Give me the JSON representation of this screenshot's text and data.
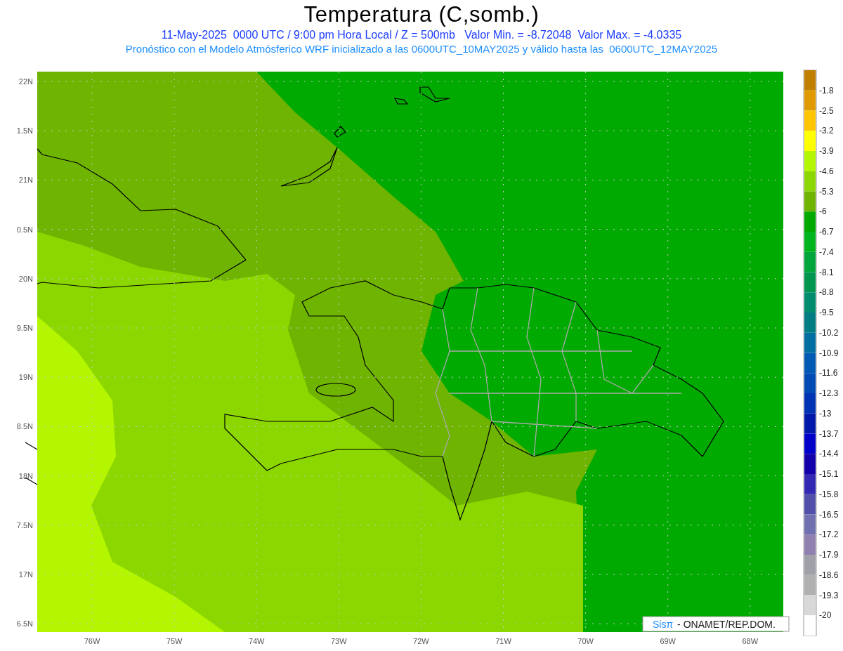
{
  "title": "Temperatura (C,somb.)",
  "subtitle": "11-May-2025  0000 UTC / 9:00 pm Hora Local / Z = 500mb   Valor Min. = -8.72048  Valor Max. = -4.0335",
  "description": "Pronóstico con el Modelo Atmósferico WRF inicializado a las 0600UTC_10MAY2025 y válido hasta las  0600UTC_12MAY2025",
  "map": {
    "y_labels": [
      "22N",
      "1.5N",
      "21N",
      "0.5N",
      "20N",
      "9.5N",
      "19N",
      "8.5N",
      "18N",
      "7.5N",
      "17N",
      "6.5N"
    ],
    "x_labels": [
      "76W",
      "75W",
      "74W",
      "73W",
      "72W",
      "71W",
      "70W",
      "69W",
      "68W"
    ],
    "credit": {
      "brand": "Sisπ",
      "text": "- ONAMET/REP.DOM."
    }
  },
  "colorbar": {
    "bins": [
      {
        "color": "#c07f00"
      },
      {
        "color": "#e09a00"
      },
      {
        "color": "#ffc400"
      },
      {
        "color": "#ffff00"
      },
      {
        "color": "#b4f500"
      },
      {
        "color": "#8cd700"
      },
      {
        "color": "#6eb400"
      },
      {
        "color": "#00aa00"
      },
      {
        "color": "#00b41e"
      },
      {
        "color": "#00a53c"
      },
      {
        "color": "#009650"
      },
      {
        "color": "#008c6e"
      },
      {
        "color": "#007d82"
      },
      {
        "color": "#006ea0"
      },
      {
        "color": "#005ab4"
      },
      {
        "color": "#004bb4"
      },
      {
        "color": "#0032b4"
      },
      {
        "color": "#0019aa"
      },
      {
        "color": "#0000c8"
      },
      {
        "color": "#1400aa"
      },
      {
        "color": "#3228b4"
      },
      {
        "color": "#5050aa"
      },
      {
        "color": "#7070b0"
      },
      {
        "color": "#9080b0"
      },
      {
        "color": "#a0a0a8"
      },
      {
        "color": "#b0b0b0"
      },
      {
        "color": "#d8d8d8"
      },
      {
        "color": "#ffffff"
      }
    ],
    "labels": [
      "-1.8",
      "-2.5",
      "-3.2",
      "-3.9",
      "-4.6",
      "-5.3",
      "-6",
      "-6.7",
      "-7.4",
      "-8.1",
      "-8.8",
      "-9.5",
      "-10.2",
      "-10.9",
      "-11.6",
      "-12.3",
      "-13",
      "-13.7",
      "-14.4",
      "-15.1",
      "-15.8",
      "-16.5",
      "-17.2",
      "-17.9",
      "-18.6",
      "-19.3",
      "-20"
    ]
  }
}
